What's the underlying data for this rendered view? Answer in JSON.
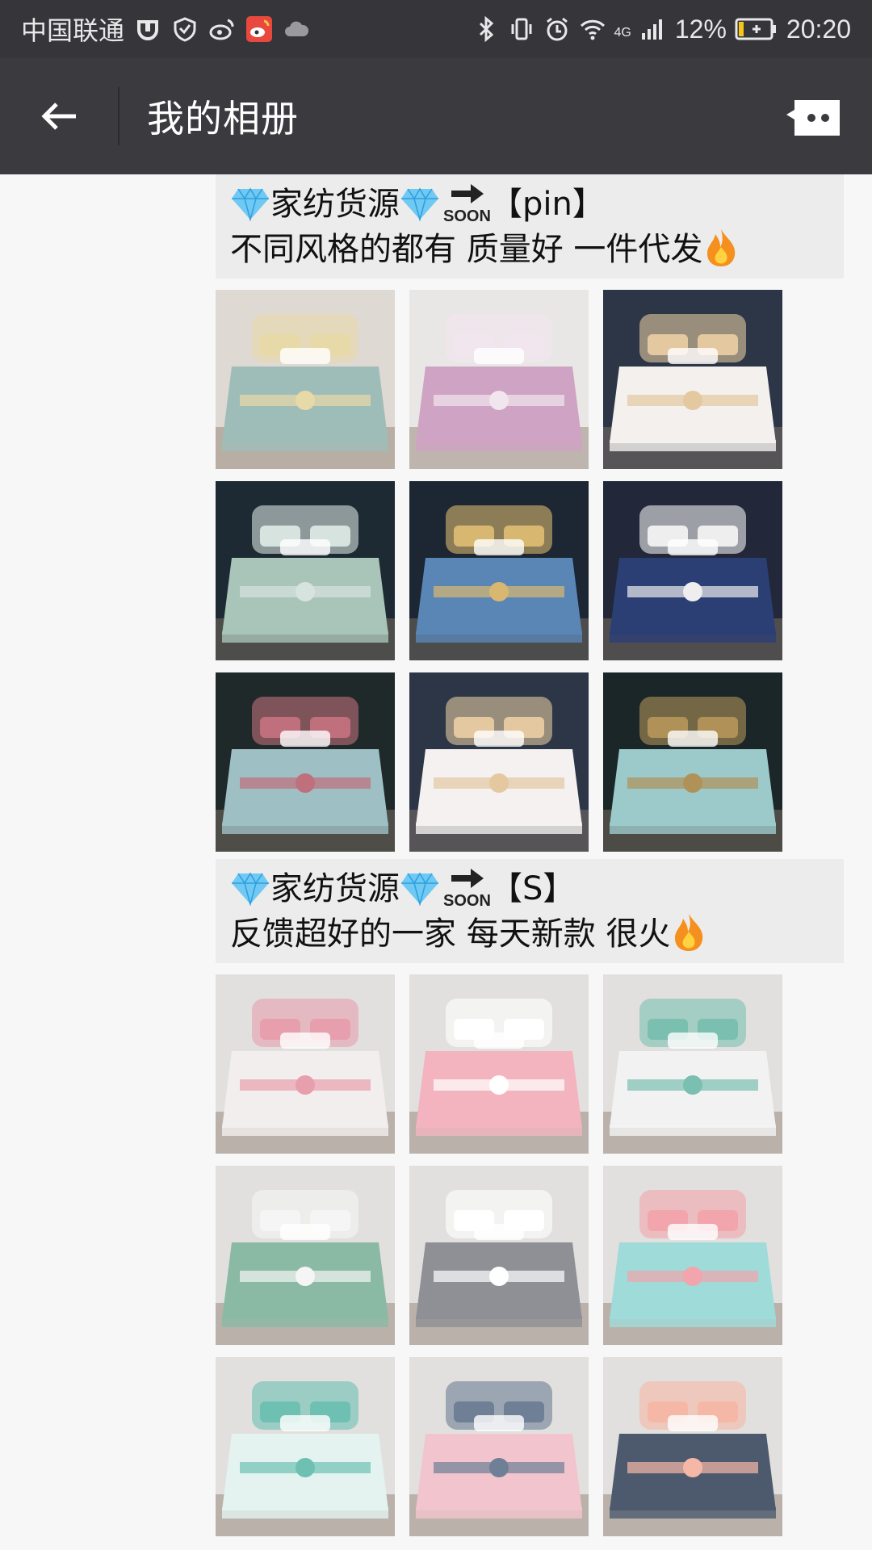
{
  "status_bar": {
    "carrier": "中国联通",
    "signal_label": "4G",
    "battery": "12%",
    "time": "20:20"
  },
  "title_bar": {
    "title": "我的相册"
  },
  "posts": [
    {
      "line1_a": "家纺货源",
      "line1_b": "【pin】",
      "line2": "不同风格的都有 质量好 一件代发",
      "thumbs": [
        {
          "name": "mint-embroidered-bedding",
          "bg": "#dfd9d4",
          "bed": "#9fbdb8",
          "accent": "#e8d9a8"
        },
        {
          "name": "pink-bedding",
          "bg": "#e9e6e6",
          "bed": "#cfa3c3",
          "accent": "#f1e6ee"
        },
        {
          "name": "white-gold-bedding",
          "bg": "#2c3647",
          "bed": "#f3f0ee",
          "accent": "#e3c8a0"
        },
        {
          "name": "sage-bedding-dark-room",
          "bg": "#1d2a33",
          "bed": "#a9c4b8",
          "accent": "#d7e3de"
        },
        {
          "name": "blue-gold-bedding",
          "bg": "#1c2733",
          "bed": "#5a86b5",
          "accent": "#d8b870"
        },
        {
          "name": "navy-white-bedding",
          "bg": "#22283a",
          "bed": "#2b3f74",
          "accent": "#eeeeee"
        },
        {
          "name": "teal-pattern-bedding",
          "bg": "#1f292a",
          "bed": "#9ec0c4",
          "accent": "#c06f7c"
        },
        {
          "name": "white-gold-bedding-2",
          "bg": "#2c3647",
          "bed": "#f4f1f0",
          "accent": "#e3c8a0"
        },
        {
          "name": "aqua-medallion-bedding",
          "bg": "#1b2628",
          "bed": "#9ccaca",
          "accent": "#b09258"
        }
      ]
    },
    {
      "line1_a": "家纺货源",
      "line1_b": "【S】",
      "line2": "反馈超好的一家 每天新款 很火",
      "thumbs": [
        {
          "name": "floral-white-bedding",
          "bg": "#e2e0de",
          "bed": "#f3eeee",
          "accent": "#e79fae"
        },
        {
          "name": "pink-polka-bedding",
          "bg": "#e2e0de",
          "bed": "#f3b4bf",
          "accent": "#ffffff"
        },
        {
          "name": "grid-white-bedding",
          "bg": "#e2e0de",
          "bed": "#f2f2f2",
          "accent": "#7bbfb0"
        },
        {
          "name": "green-diamond-bedding",
          "bg": "#e2e0de",
          "bed": "#8ab9a4",
          "accent": "#f5f5f5"
        },
        {
          "name": "grey-flower-bedding",
          "bg": "#e2e0de",
          "bed": "#8e9096",
          "accent": "#ffffff"
        },
        {
          "name": "aqua-cartoon-bedding",
          "bg": "#e2e0de",
          "bed": "#9fdbd9",
          "accent": "#f2a5ad"
        },
        {
          "name": "mint-chevron-bedding",
          "bg": "#e2e0de",
          "bed": "#e4f3f0",
          "accent": "#6ec0b2"
        },
        {
          "name": "pink-cat-bedding",
          "bg": "#e2e0de",
          "bed": "#f2c4cd",
          "accent": "#6e7f96"
        },
        {
          "name": "navy-dots-bedding",
          "bg": "#e2e0de",
          "bed": "#4d5a6e",
          "accent": "#f6b8a6"
        }
      ]
    }
  ]
}
